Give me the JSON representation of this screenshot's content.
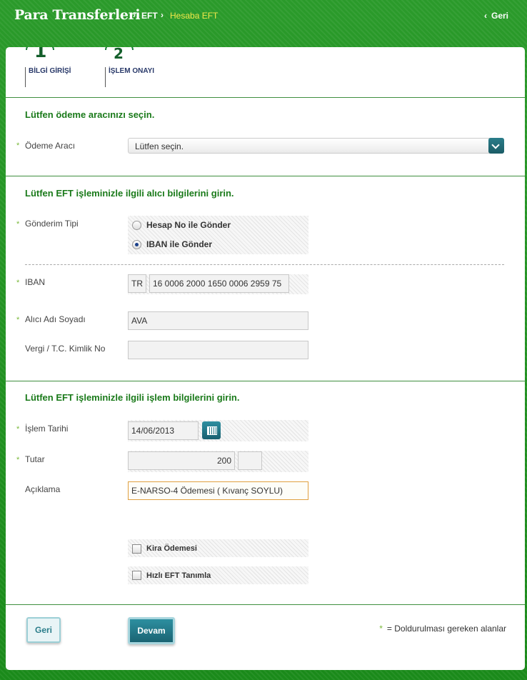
{
  "header": {
    "title": "Para Transferleri",
    "sep1": "›",
    "crumb1": "EFT",
    "sep2": "›",
    "crumb2": "Hesaba EFT",
    "back_arrow": "‹",
    "back_label": "Geri"
  },
  "steps": [
    {
      "number": "1",
      "label": "BİLGİ GİRİŞİ"
    },
    {
      "number": "2",
      "label": "İŞLEM ONAYI"
    }
  ],
  "section1": {
    "heading": "Lütfen ödeme aracınızı seçin.",
    "odeme_label": "Ödeme Aracı",
    "odeme_value": "Lütfen seçin."
  },
  "section2": {
    "heading": "Lütfen EFT işleminizle ilgili alıcı bilgilerini girin.",
    "gonderim_label": "Gönderim Tipi",
    "radio_options": [
      "Hesap No ile Gönder",
      "IBAN ile Gönder"
    ],
    "selected_option": "IBAN ile Gönder",
    "iban_label": "IBAN",
    "iban_prefix": "TR",
    "iban_value": "16 0006 2000 1650 0006 2959 75",
    "alici_label": "Alıcı Adı Soyadı",
    "alici_value": "AVA",
    "vergi_label": "Vergi / T.C. Kimlik No",
    "vergi_value": ""
  },
  "section3": {
    "heading": "Lütfen EFT işleminizle ilgili işlem bilgilerini girin.",
    "tarih_label": "İşlem Tarihi",
    "tarih_value": "14/06/2013",
    "tutar_label": "Tutar",
    "tutar_value": "200",
    "tutar_decimal": "",
    "aciklama_label": "Açıklama",
    "aciklama_value": "E-NARSO-4 Ödemesi ( Kıvanç SOYLU)",
    "kira_label": "Kira Ödemesi",
    "hizli_label": "Hızlı EFT Tanımla"
  },
  "required_star": "*",
  "footer": {
    "geri_label": "Geri",
    "devam_label": "Devam",
    "required_note": "= Doldurulması gereken alanlar"
  },
  "icons": {
    "dropdown": "chevron-down-icon",
    "calendar": "calendar-icon"
  },
  "colors": {
    "brand_green": "#1f8f1f",
    "heading_green": "#1a7a1a",
    "button_teal": "#1b6473",
    "crumb_active": "#f2e84a"
  }
}
